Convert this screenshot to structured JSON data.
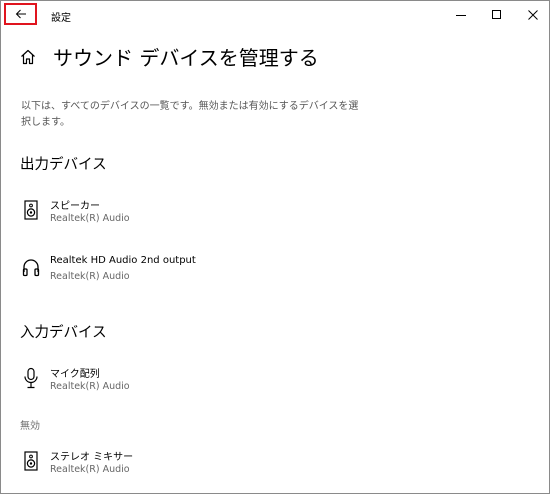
{
  "titlebar": {
    "app_title": "設定",
    "back_icon": "arrow-left-icon",
    "minimize_icon": "minimize-icon",
    "maximize_icon": "maximize-icon",
    "close_icon": "close-icon",
    "highlight_color": "#e0141e"
  },
  "header": {
    "home_icon": "home-icon",
    "title": "サウンド デバイスを管理する"
  },
  "description": "以下は、すべてのデバイスの一覧です。無効または有効にするデバイスを選択します。",
  "output": {
    "heading": "出力デバイス",
    "devices": [
      {
        "name": "スピーカー",
        "driver": "Realtek(R) Audio",
        "icon": "speaker-icon"
      },
      {
        "name": "Realtek HD Audio 2nd output",
        "driver": "Realtek(R) Audio",
        "icon": "headphones-icon"
      }
    ]
  },
  "input": {
    "heading": "入力デバイス",
    "devices": [
      {
        "name": "マイク配列",
        "driver": "Realtek(R) Audio",
        "icon": "microphone-icon"
      }
    ],
    "disabled_label": "無効",
    "disabled_devices": [
      {
        "name": "ステレオ ミキサー",
        "driver": "Realtek(R) Audio",
        "icon": "speaker-icon"
      }
    ]
  }
}
